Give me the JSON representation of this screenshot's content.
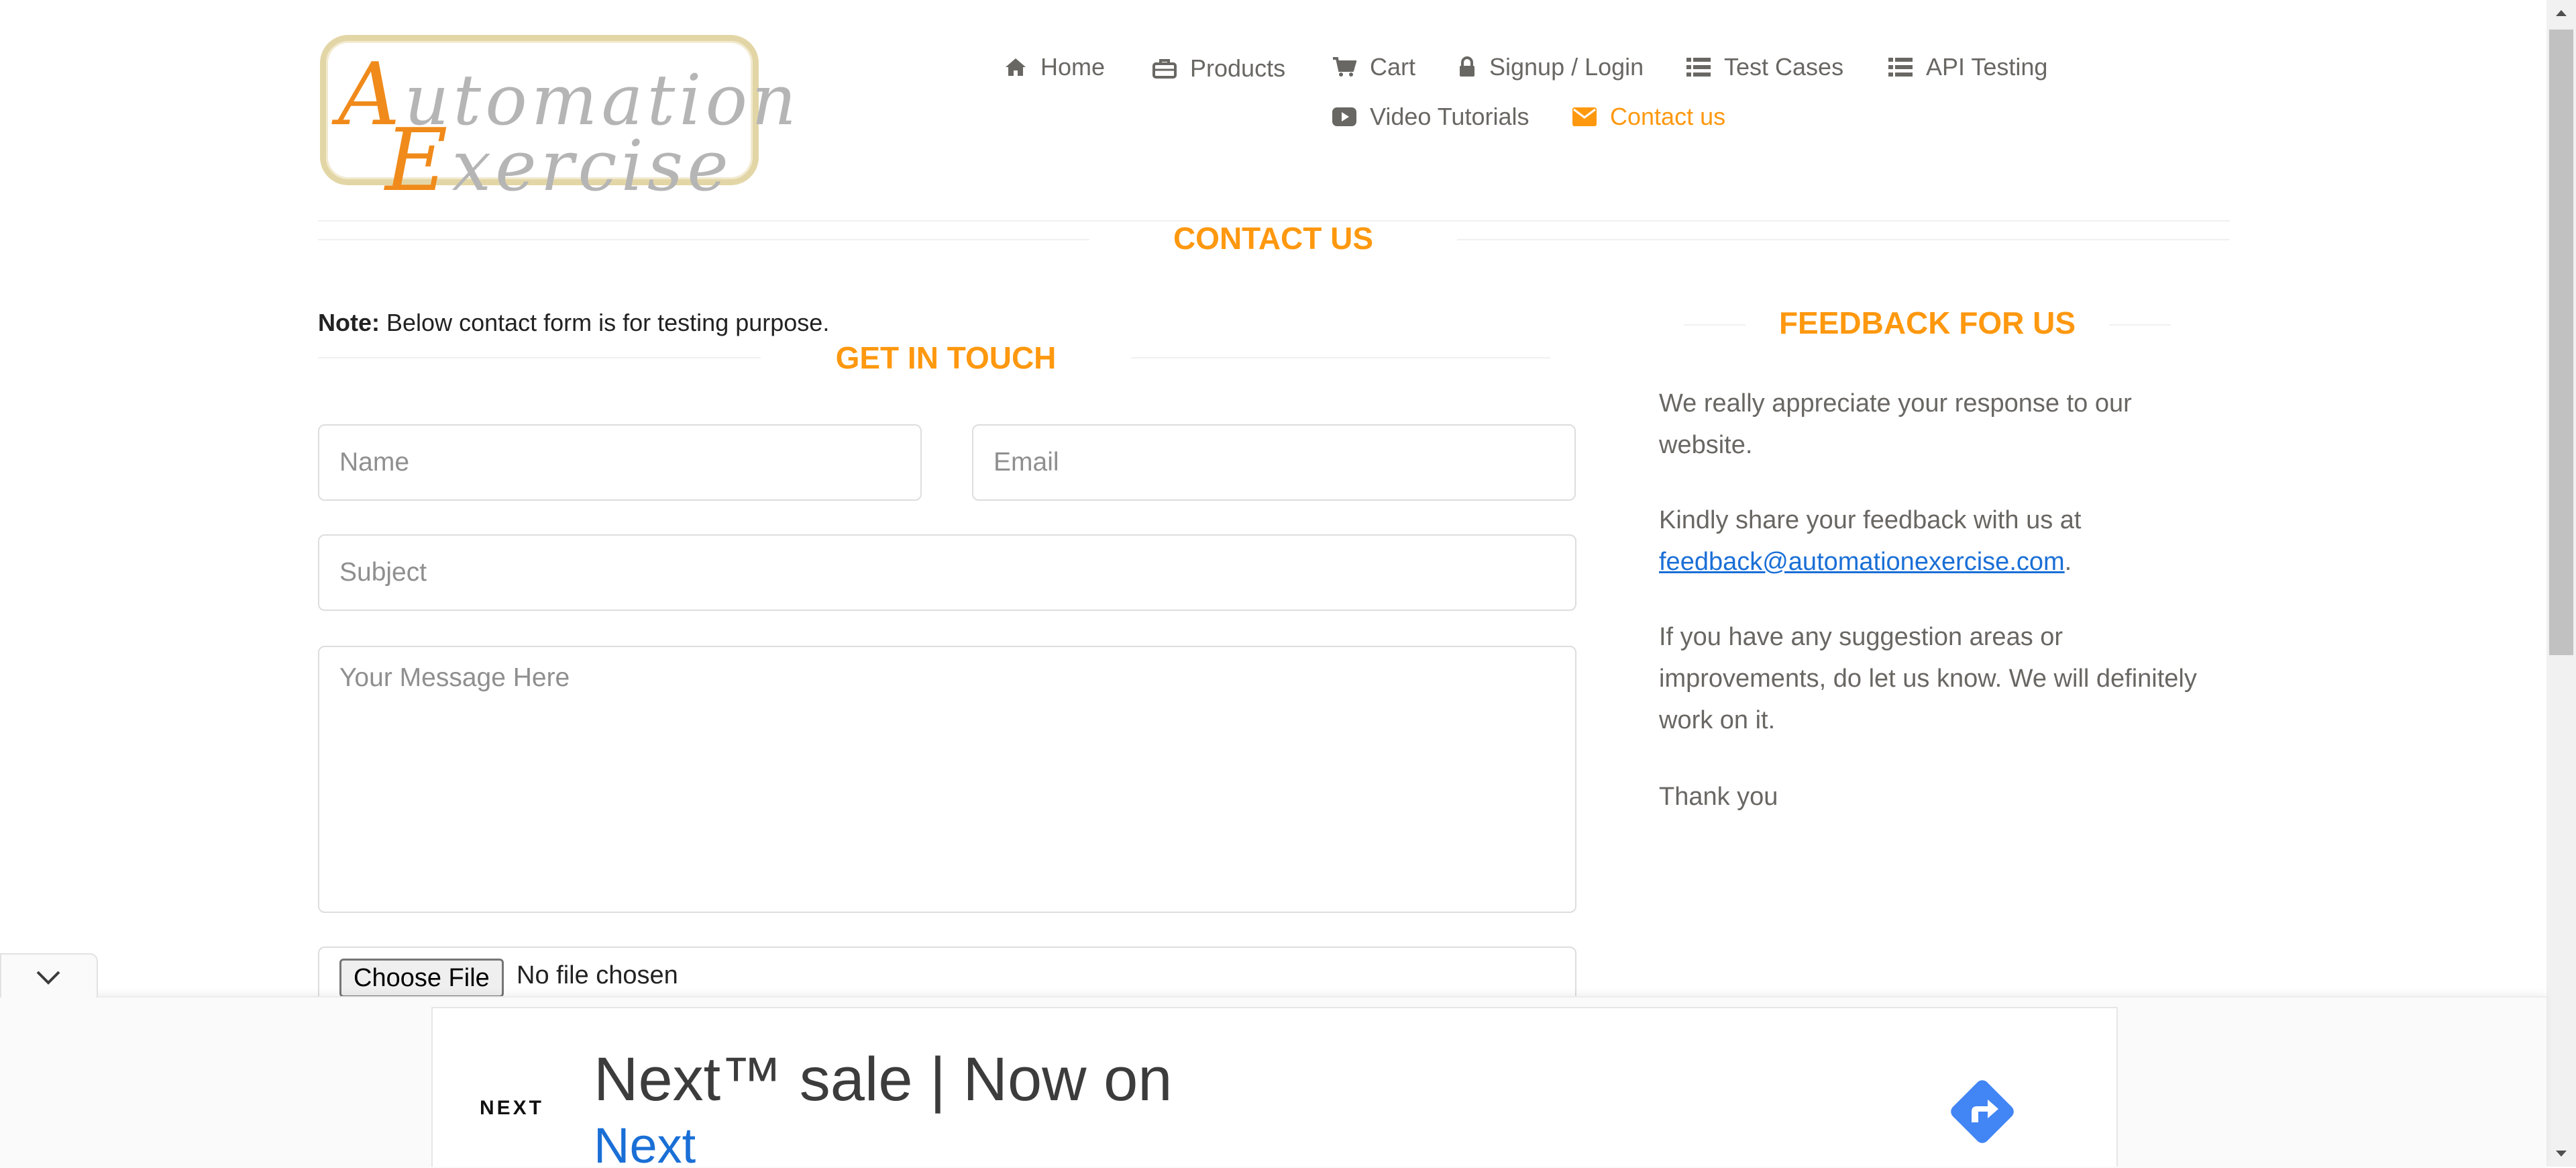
{
  "logo": {
    "line1_first": "A",
    "line1_rest": "utomation",
    "line2_first": "E",
    "line2_rest": "xercise"
  },
  "nav": {
    "home": "Home",
    "products": "Products",
    "cart": "Cart",
    "signup_login": "Signup / Login",
    "test_cases": "Test Cases",
    "api_testing": "API Testing",
    "video_tutorials": "Video Tutorials",
    "contact_us": "Contact us"
  },
  "page_title": "CONTACT US",
  "note": {
    "label": "Note:",
    "text": "Below contact form is for testing purpose."
  },
  "get_in_touch": "GET IN TOUCH",
  "form": {
    "name_placeholder": "Name",
    "email_placeholder": "Email",
    "subject_placeholder": "Subject",
    "message_placeholder": "Your Message Here",
    "choose_file": "Choose File",
    "file_status": "No file chosen"
  },
  "feedback": {
    "title": "FEEDBACK FOR US",
    "p1": "We really appreciate your response to our website.",
    "p2_before": "Kindly share your feedback with us at",
    "p2_link": "feedback@automationexercise.com",
    "p2_after": ".",
    "p3": "If you have any suggestion areas or improvements, do let us know. We will definitely work on it.",
    "p4": "Thank you"
  },
  "ad": {
    "brand": "NEXT",
    "headline": "Next™ sale | Now on",
    "subline": "Next"
  },
  "colors": {
    "accent": "#FE980F",
    "text": "#696763",
    "link": "#1A6FD6",
    "ad_button": "#4285F4"
  }
}
